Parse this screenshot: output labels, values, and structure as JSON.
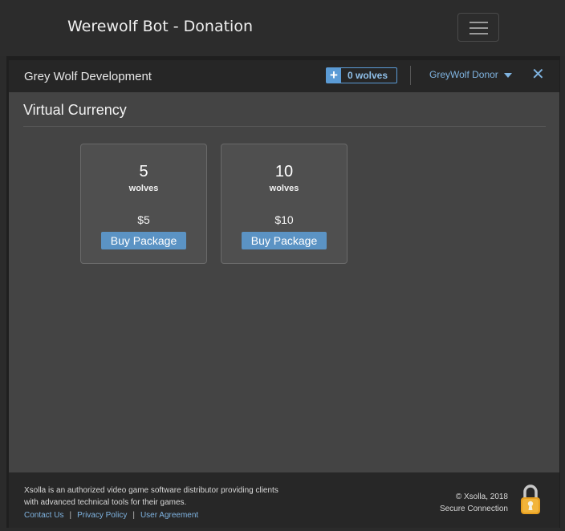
{
  "site": {
    "title": "Werewolf Bot - Donation"
  },
  "header": {
    "merchant": "Grey Wolf Development",
    "balance": "0 wolves",
    "user": "GreyWolf Donor"
  },
  "section": {
    "title": "Virtual Currency"
  },
  "packages": [
    {
      "amount": "5",
      "unit": "wolves",
      "price": "$5",
      "button": "Buy Package"
    },
    {
      "amount": "10",
      "unit": "wolves",
      "price": "$10",
      "button": "Buy Package"
    }
  ],
  "footer": {
    "legal_line1": "Xsolla is an authorized video game software distributor providing clients",
    "legal_line2": "with advanced technical tools for their games.",
    "links": [
      "Contact Us",
      "Privacy Policy",
      "User Agreement"
    ],
    "copyright": "© Xsolla, 2018",
    "secure": "Secure Connection"
  },
  "colors": {
    "accent": "#5b9bd5",
    "link": "#7fb3e0",
    "button": "#5b93c4"
  },
  "icons": {
    "menu": "hamburger-icon",
    "balance_add": "plus-icon",
    "user_menu": "caret-down-icon",
    "close": "close-icon",
    "secure": "padlock-icon"
  }
}
